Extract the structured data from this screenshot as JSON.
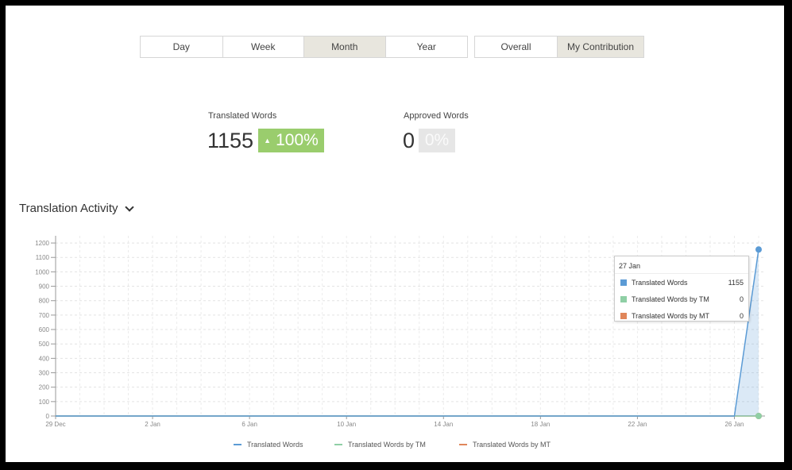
{
  "period_tabs": [
    "Day",
    "Week",
    "Month",
    "Year"
  ],
  "scope_tabs": [
    "Overall",
    "My Contribution"
  ],
  "active_period": "Month",
  "active_scope": "My Contribution",
  "stats": {
    "translated": {
      "label": "Translated Words",
      "value": "1155",
      "change": "100%"
    },
    "approved": {
      "label": "Approved Words",
      "value": "0",
      "change": "0%"
    }
  },
  "section_title": "Translation Activity",
  "tooltip": {
    "date": "27 Jan",
    "rows": [
      {
        "label": "Translated Words",
        "value": "1155",
        "color": "#5b9bd5"
      },
      {
        "label": "Translated Words by TM",
        "value": "0",
        "color": "#8fcfa5"
      },
      {
        "label": "Translated Words by MT",
        "value": "0",
        "color": "#e0865a"
      }
    ]
  },
  "chart_data": {
    "type": "area",
    "x": [
      "29 Dec",
      "30 Dec",
      "31 Dec",
      "1 Jan",
      "2 Jan",
      "3 Jan",
      "4 Jan",
      "5 Jan",
      "6 Jan",
      "7 Jan",
      "8 Jan",
      "9 Jan",
      "10 Jan",
      "11 Jan",
      "12 Jan",
      "13 Jan",
      "14 Jan",
      "15 Jan",
      "16 Jan",
      "17 Jan",
      "18 Jan",
      "19 Jan",
      "20 Jan",
      "21 Jan",
      "22 Jan",
      "23 Jan",
      "24 Jan",
      "25 Jan",
      "26 Jan",
      "27 Jan"
    ],
    "x_tick_labels": [
      "29 Dec",
      "2 Jan",
      "6 Jan",
      "10 Jan",
      "14 Jan",
      "18 Jan",
      "22 Jan",
      "26 Jan"
    ],
    "y_ticks": [
      0,
      100,
      200,
      300,
      400,
      500,
      600,
      700,
      800,
      900,
      1000,
      1100,
      1200
    ],
    "ylim": [
      0,
      1250
    ],
    "grid": true,
    "legend": "bottom",
    "series": [
      {
        "name": "Translated Words",
        "color": "#5b9bd5",
        "values": [
          0,
          0,
          0,
          0,
          0,
          0,
          0,
          0,
          0,
          0,
          0,
          0,
          0,
          0,
          0,
          0,
          0,
          0,
          0,
          0,
          0,
          0,
          0,
          0,
          0,
          0,
          0,
          0,
          0,
          1155
        ]
      },
      {
        "name": "Translated Words by TM",
        "color": "#8fcfa5",
        "values": [
          0,
          0,
          0,
          0,
          0,
          0,
          0,
          0,
          0,
          0,
          0,
          0,
          0,
          0,
          0,
          0,
          0,
          0,
          0,
          0,
          0,
          0,
          0,
          0,
          0,
          0,
          0,
          0,
          0,
          0
        ]
      },
      {
        "name": "Translated Words by MT",
        "color": "#e0865a",
        "values": [
          0,
          0,
          0,
          0,
          0,
          0,
          0,
          0,
          0,
          0,
          0,
          0,
          0,
          0,
          0,
          0,
          0,
          0,
          0,
          0,
          0,
          0,
          0,
          0,
          0,
          0,
          0,
          0,
          0,
          0
        ]
      }
    ]
  }
}
